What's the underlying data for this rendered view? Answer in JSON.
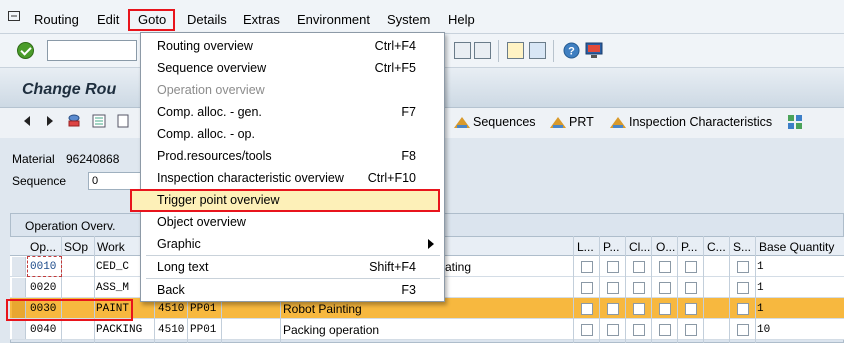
{
  "menubar": {
    "items": [
      {
        "label": "Routing",
        "mnemonic": "R"
      },
      {
        "label": "Edit",
        "mnemonic": "E"
      },
      {
        "label": "Goto",
        "mnemonic": "G"
      },
      {
        "label": "Details",
        "mnemonic": "D"
      },
      {
        "label": "Extras",
        "mnemonic": "x"
      },
      {
        "label": "Environment",
        "mnemonic": "n"
      },
      {
        "label": "System",
        "mnemonic": "S"
      },
      {
        "label": "Help",
        "mnemonic": "H"
      }
    ]
  },
  "title": "Change Rou",
  "app_toolbar": {
    "sequences": "Sequences",
    "prt": "PRT",
    "inspection": "Inspection Characteristics"
  },
  "header": {
    "material_label": "Material",
    "material_value": "96240868",
    "sequence_label": "Sequence",
    "sequence_value": "0"
  },
  "table": {
    "title": "Operation Overv.",
    "columns": [
      "Op...",
      "SOp",
      "Work",
      "L...",
      "P...",
      "Cl...",
      "O...",
      "P...",
      "C...",
      "S...",
      "Base Quantity"
    ],
    "rows": [
      {
        "op": "0010",
        "work": "CED_C",
        "plant": "",
        "ctrl": "",
        "desc": "ating",
        "qty": "1",
        "selected": false
      },
      {
        "op": "0020",
        "work": "ASS_M",
        "plant": "",
        "ctrl": "",
        "desc": "",
        "qty": "1",
        "selected": false
      },
      {
        "op": "0030",
        "work": "PAINT",
        "plant": "4510",
        "ctrl": "PP01",
        "desc": "Robot Painting",
        "qty": "1",
        "selected": true
      },
      {
        "op": "0040",
        "work": "PACKING",
        "plant": "4510",
        "ctrl": "PP01",
        "desc": "Packing operation",
        "qty": "10",
        "selected": false
      }
    ]
  },
  "goto_menu": {
    "items": [
      {
        "label": "Routing overview",
        "shortcut": "Ctrl+F4",
        "disabled": false
      },
      {
        "label": "Sequence overview",
        "shortcut": "Ctrl+F5",
        "disabled": false
      },
      {
        "label": "Operation overview",
        "shortcut": "",
        "disabled": true
      },
      {
        "label": "Comp. alloc. - gen.",
        "shortcut": "F7",
        "disabled": false
      },
      {
        "label": "Comp. alloc. - op.",
        "shortcut": "",
        "disabled": false
      },
      {
        "label": "Prod.resources/tools",
        "shortcut": "F8",
        "disabled": false
      },
      {
        "label": "Inspection characteristic overview",
        "shortcut": "Ctrl+F10",
        "disabled": false
      },
      {
        "label": "Trigger point overview",
        "shortcut": "",
        "disabled": false,
        "highlighted": true
      },
      {
        "label": "Object overview",
        "shortcut": "",
        "disabled": false
      },
      {
        "label": "Graphic",
        "shortcut": "",
        "disabled": false,
        "submenu": true
      },
      {
        "label": "Long text",
        "shortcut": "Shift+F4",
        "disabled": false
      },
      {
        "label": "Back",
        "shortcut": "F3",
        "disabled": false
      }
    ]
  },
  "colors": {
    "highlight_border": "#e8141c",
    "selected_row": "#f7b83f"
  }
}
